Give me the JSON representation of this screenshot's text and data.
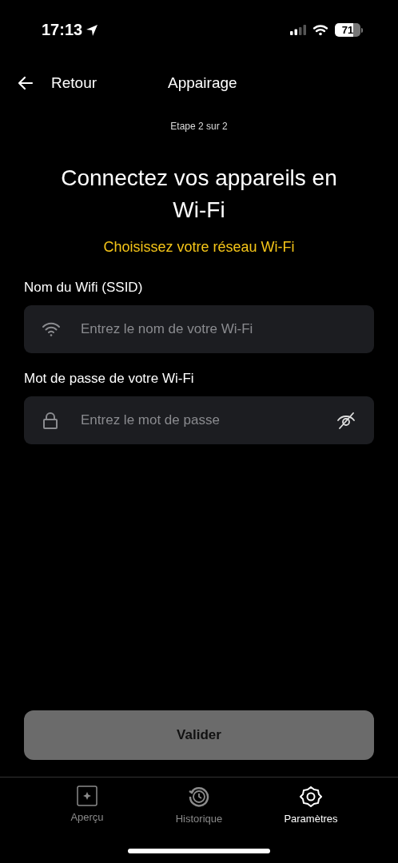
{
  "status_bar": {
    "time": "17:13",
    "battery": "71"
  },
  "nav": {
    "back": "Retour",
    "title": "Appairage"
  },
  "step": "Etape 2 sur 2",
  "heading": "Connectez vos appareils en Wi-Fi",
  "subheading": "Choisissez votre réseau Wi-Fi",
  "fields": [
    {
      "kind": "wifi",
      "label": "Nom du Wifi (SSID)",
      "placeholder": "Entrez le nom de votre Wi-Fi"
    },
    {
      "kind": "password",
      "label": "Mot de passe de votre Wi-Fi",
      "placeholder": "Entrez le mot de passe"
    }
  ],
  "submit": {
    "label": "Valider",
    "disabled": true
  },
  "tabs": [
    {
      "kind": "overview",
      "label": "Aperçu",
      "selected": false
    },
    {
      "kind": "history",
      "label": "Historique",
      "selected": false
    },
    {
      "kind": "settings",
      "label": "Paramètres",
      "selected": true
    }
  ]
}
